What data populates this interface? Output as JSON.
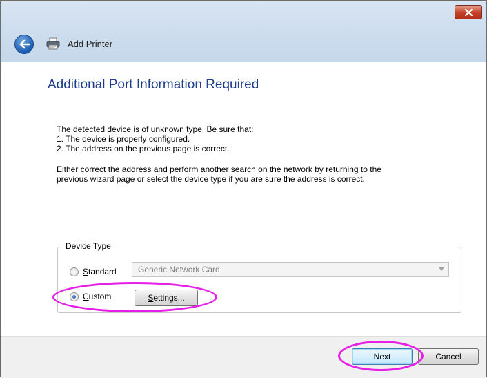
{
  "window": {
    "title_bar": {
      "close_label": "×"
    },
    "nav": {
      "title": "Add Printer"
    }
  },
  "main": {
    "heading": "Additional Port Information Required",
    "description_lines": [
      "The detected device is of unknown type.  Be sure that:",
      "1. The device is properly configured.",
      "2.  The address on the previous page is correct.",
      "Either correct the address and perform another search on the network by returning to the",
      "previous wizard page or select the device type if you are sure the address is correct."
    ],
    "device_type": {
      "label": "Device Type",
      "standard": {
        "label_prefix": "",
        "label_underline": "S",
        "label_rest": "tandard",
        "selected": false
      },
      "standard_combo_value": "Generic Network Card",
      "custom": {
        "label_prefix": "",
        "label_underline": "C",
        "label_rest": "ustom",
        "selected": true
      },
      "settings_button": {
        "label_prefix": "",
        "label_underline": "S",
        "label_rest": "ettings..."
      }
    }
  },
  "footer": {
    "next_label": "Next",
    "cancel_label": "Cancel"
  },
  "colors": {
    "heading": "#1e3d8c",
    "highlight": "#e61fe6",
    "close_button": "#c4412a"
  },
  "icons": [
    "close-icon",
    "back-arrow-icon",
    "printer-icon",
    "dropdown-arrow-icon"
  ]
}
